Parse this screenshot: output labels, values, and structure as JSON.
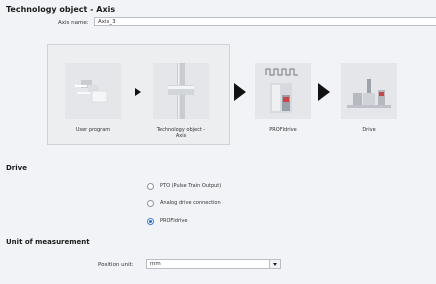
{
  "header": {
    "title": "Technology object - Axis",
    "axis_name_label": "Axis name:",
    "axis_name_value": "Axis_3"
  },
  "diagram": {
    "items": [
      {
        "label": "User program",
        "icon": "user-program-icon"
      },
      {
        "label": "Technology object -\nAxis",
        "icon": "technology-object-icon"
      },
      {
        "label": "PROFIdrive",
        "icon": "profidrive-icon"
      },
      {
        "label": "Drive",
        "icon": "drive-icon"
      }
    ]
  },
  "drive": {
    "heading": "Drive",
    "options": [
      {
        "label": "PTO (Pulse Train Output)",
        "selected": false
      },
      {
        "label": "Analog drive connection",
        "selected": false
      },
      {
        "label": "PROFIdrive",
        "selected": true
      }
    ]
  },
  "unit": {
    "heading": "Unit of measurement",
    "position_label": "Position unit:",
    "position_value": "mm"
  },
  "colors": {
    "accent": "#1f6fd1",
    "background": "#f2f3f6"
  }
}
